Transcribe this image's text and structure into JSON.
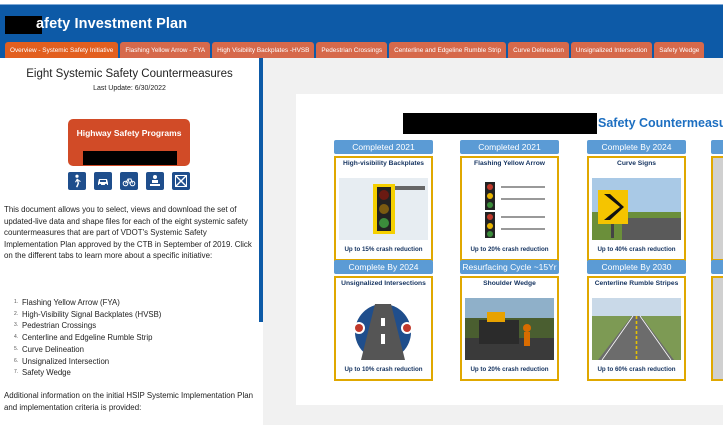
{
  "header": {
    "title": "afety Investment Plan"
  },
  "tabs": [
    {
      "label": "Overview - Systemic Safety Initiative",
      "active": true
    },
    {
      "label": "Flashing Yellow Arrow - FYA",
      "active": false
    },
    {
      "label": "High Visibility Backplates -HVSB",
      "active": false
    },
    {
      "label": "Pedestrian Crossings",
      "active": false
    },
    {
      "label": "Centerline and Edgeline Rumble Strip",
      "active": false
    },
    {
      "label": "Curve Delineation",
      "active": false
    },
    {
      "label": "Unsignalized Intersection",
      "active": false
    },
    {
      "label": "Safety Wedge",
      "active": false
    }
  ],
  "left": {
    "title": "Eight Systemic Safety Countermeasures",
    "last_update": "Last Update: 6/30/2022",
    "hsp_title": "Highway Safety Programs",
    "mode_icons": [
      "pedestrian-icon",
      "car-icon",
      "bicycle-icon",
      "driver-icon",
      "intersection-icon"
    ],
    "description": "This document allows you to select, views and download the set of updated-live data and shape files for each of the eight systemic safety countermeasures that are part of VDOT's Systemic Safety Implementation Plan approved by the CTB in September of 2019. Click on the different tabs to learn more about a specific initiative:",
    "initiatives": [
      {
        "num": "1.",
        "label": "Flashing Yellow Arrow (FYA)"
      },
      {
        "num": "2.",
        "label": "High-Visibility Signal Backplates (HVSB)"
      },
      {
        "num": "3.",
        "label": "Pedestrian Crossings"
      },
      {
        "num": "4.",
        "label": "Centerline and Edgeline Rumble Strip"
      },
      {
        "num": "5.",
        "label": "Curve Delineation"
      },
      {
        "num": "6.",
        "label": "Unsignalized Intersection"
      },
      {
        "num": "7.",
        "label": "Safety Wedge"
      }
    ],
    "additional": "Additional information on the initial HSIP Systemic Implementation Plan and implementation criteria is provided:"
  },
  "infographic": {
    "title": "Safety Countermeasu",
    "cards": [
      {
        "status": "Completed 2021",
        "title": "High-visibility Backplates",
        "reduction": "Up to 15%  crash reduction"
      },
      {
        "status": "Completed 2021",
        "title": "Flashing Yellow Arrow",
        "reduction": "Up to 20% crash reduction"
      },
      {
        "status": "Complete By 2024",
        "title": "Curve Signs",
        "reduction": "Up to 40%  crash reduction"
      },
      {
        "status": "Complete By 2024",
        "title": "Unsignalized Intersections",
        "reduction": "Up to 10%  crash reduction"
      },
      {
        "status": "Resurfacing Cycle ~15Yr",
        "title": "Shoulder Wedge",
        "reduction": "Up to 20% crash reduction"
      },
      {
        "status": "Complete By 2030",
        "title": "Centerline Rumble Stripes",
        "reduction": "Up to 60% crash reduction"
      }
    ]
  },
  "colors": {
    "header_blue": "#0d5aa7",
    "tab_orange": "#d6694b",
    "hsp_red": "#d14b27",
    "badge_blue": "#5b9bd5",
    "card_border": "#e0a800",
    "title_blue": "#1d6fc1"
  }
}
